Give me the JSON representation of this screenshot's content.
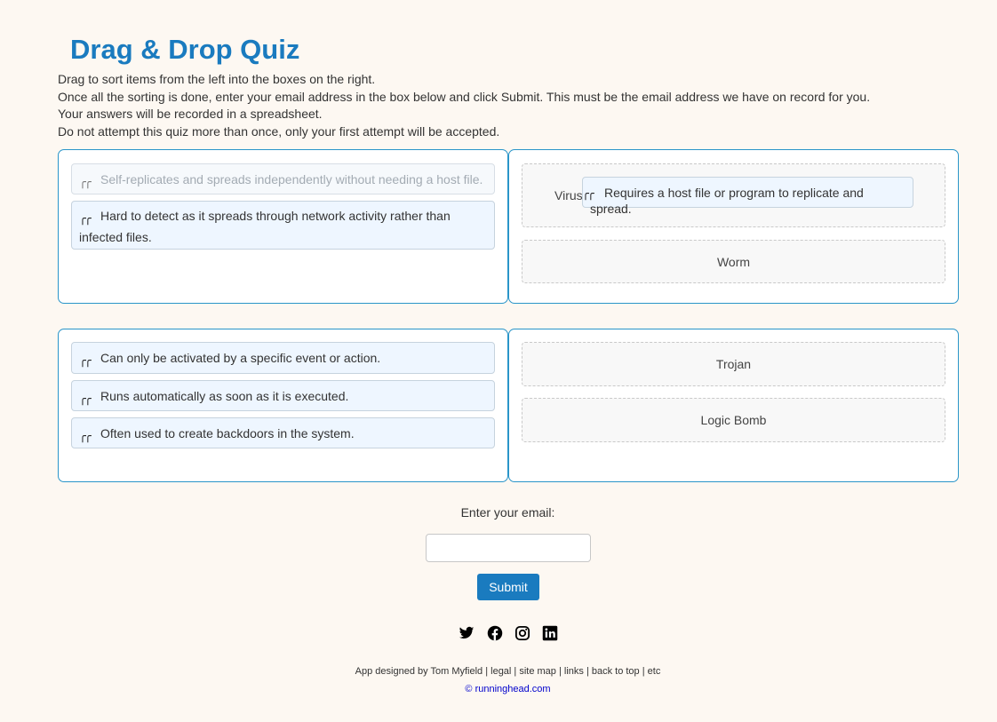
{
  "title": "Drag & Drop Quiz",
  "instructions": [
    "Drag to sort items from the left into the boxes on the right.",
    "Once all the sorting is done, enter your email address in the box below and click Submit. This must be the email address we have on record for you.",
    "Your answers will be recorded in a spreadsheet.",
    "Do not attempt this quiz more than once, only your first attempt will be accepted."
  ],
  "grip_glyph": "╭╭",
  "group1": {
    "items": [
      "Self-replicates and spreads independently without needing a host file.",
      "Hard to detect as it spreads through network activity rather than infected files."
    ],
    "zones": [
      {
        "label": "Virus",
        "placed": "Requires a host file or program to replicate and spread."
      },
      {
        "label": "Worm"
      }
    ]
  },
  "group2": {
    "items": [
      "Can only be activated by a specific event or action.",
      "Runs automatically as soon as it is executed.",
      "Often used to create backdoors in the system."
    ],
    "zones": [
      {
        "label": "Trojan"
      },
      {
        "label": "Logic Bomb"
      }
    ]
  },
  "email": {
    "label": "Enter your email:",
    "value": "",
    "placeholder": ""
  },
  "submit_label": "Submit",
  "social": [
    "twitter-icon",
    "facebook-icon",
    "instagram-icon",
    "linkedin-icon"
  ],
  "footer": {
    "line1": "App designed by Tom Myfield | legal | site map | links | back to top | etc",
    "line2": "© runninghead.com"
  },
  "colors": {
    "accent": "#1a7bbf",
    "background": "#fdf8f2",
    "panel_border": "#2a95c9"
  }
}
